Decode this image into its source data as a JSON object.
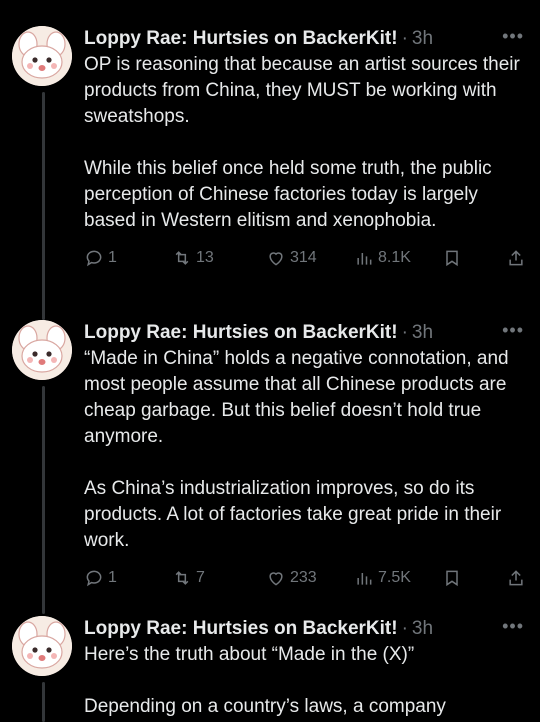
{
  "tweets": [
    {
      "author": "Loppy Rae: Hurtsies on BackerKit!",
      "time": "3h",
      "text": "OP is reasoning that because an artist sources their products from China, they MUST be working with sweatshops.\n\nWhile this belief once held some truth, the public perception of Chinese factories today is largely based in Western elitism and xenophobia.",
      "replies": "1",
      "reposts": "13",
      "likes": "314",
      "views": "8.1K"
    },
    {
      "author": "Loppy Rae: Hurtsies on BackerKit!",
      "time": "3h",
      "text": "“Made in China” holds a negative connotation, and most people assume that all Chinese products are cheap garbage. But this belief doesn’t hold true anymore.\n\nAs China’s industrialization improves, so do its products. A lot of factories take great pride in their work.",
      "replies": "1",
      "reposts": "7",
      "likes": "233",
      "views": "7.5K"
    },
    {
      "author": "Loppy Rae: Hurtsies on BackerKit!",
      "time": "3h",
      "text": "Here’s the truth about “Made in the (X)”\n\nDepending on a country’s laws, a company",
      "replies": "",
      "reposts": "",
      "likes": "",
      "views": ""
    }
  ],
  "separator": "·",
  "more_glyph": "•••",
  "colors": {
    "background": "#000000",
    "text": "#e7e9ea",
    "muted": "#71767b",
    "thread_line": "#333639"
  }
}
